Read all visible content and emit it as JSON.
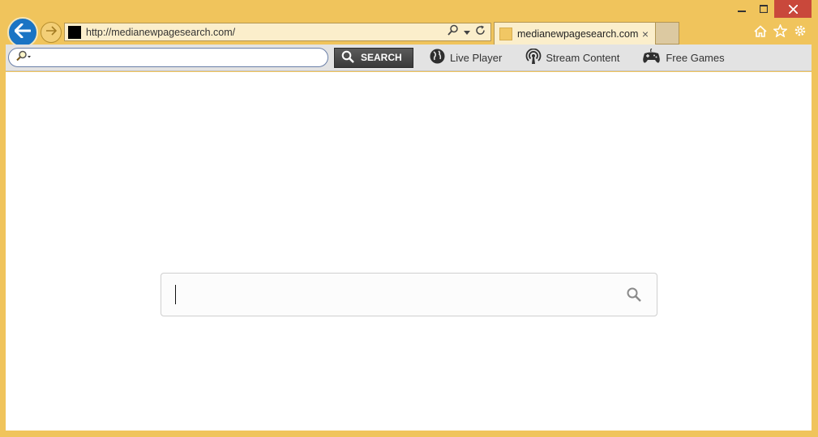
{
  "browser": {
    "address": {
      "url": "http://medianewpagesearch.com/"
    },
    "tab": {
      "title": "medianewpagesearch.com",
      "close": "×"
    }
  },
  "toolbar": {
    "search_button": "SEARCH",
    "links": [
      {
        "label": "Live Player"
      },
      {
        "label": "Stream Content"
      },
      {
        "label": "Free Games"
      }
    ]
  },
  "main": {
    "search": {
      "value": "",
      "placeholder": ""
    }
  },
  "colors": {
    "frame": "#f0c45c",
    "close_button": "#c9483b",
    "back_button": "#1a74c4"
  },
  "icons": [
    "back-arrow-icon",
    "forward-arrow-icon",
    "search-icon",
    "dropdown-icon",
    "refresh-icon",
    "home-icon",
    "star-icon",
    "gear-icon",
    "globe-icon",
    "broadcast-icon",
    "gamepad-icon"
  ]
}
